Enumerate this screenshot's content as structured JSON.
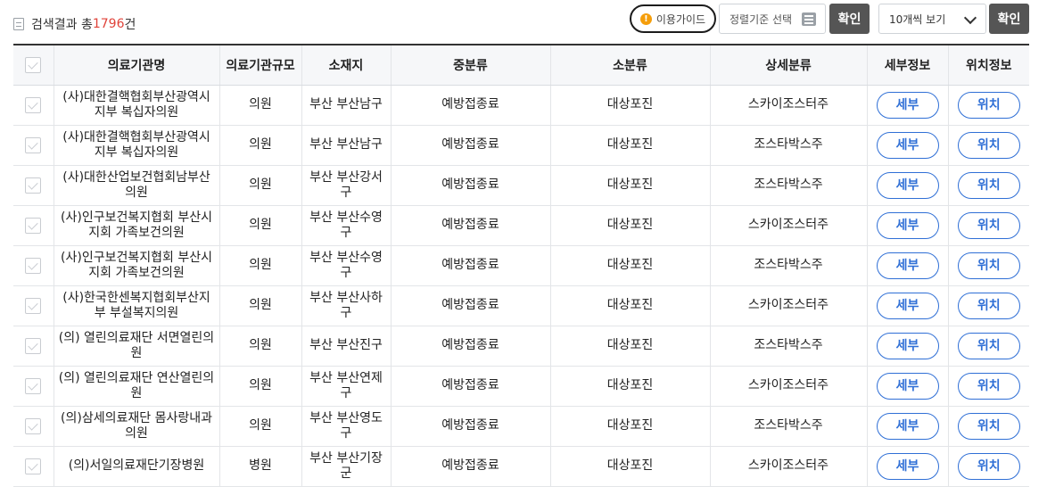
{
  "summary": {
    "prefix": "검색결과 총",
    "count": "1796",
    "suffix": "건"
  },
  "toolbar": {
    "guide_label": "이용가이드",
    "sort_placeholder": "정렬기준 선택",
    "confirm_label": "확인",
    "page_size_value": "10개씩 보기",
    "confirm2_label": "확인"
  },
  "table": {
    "headers": [
      "의료기관명",
      "의료기관규모",
      "소재지",
      "중분류",
      "소분류",
      "상세분류",
      "세부정보",
      "위치정보"
    ],
    "detail_label": "세부",
    "location_label": "위치",
    "rows": [
      {
        "name": "(사)대한결핵협회부산광역시지부 복십자의원",
        "scale": "의원",
        "location": "부산 부산남구",
        "mid": "예방접종료",
        "sub": "대상포진",
        "detail": "스카이조스터주"
      },
      {
        "name": "(사)대한결핵협회부산광역시지부 복십자의원",
        "scale": "의원",
        "location": "부산 부산남구",
        "mid": "예방접종료",
        "sub": "대상포진",
        "detail": "조스타박스주"
      },
      {
        "name": "(사)대한산업보건협회남부산의원",
        "scale": "의원",
        "location": "부산 부산강서구",
        "mid": "예방접종료",
        "sub": "대상포진",
        "detail": "조스타박스주"
      },
      {
        "name": "(사)인구보건복지협회 부산시지회 가족보건의원",
        "scale": "의원",
        "location": "부산 부산수영구",
        "mid": "예방접종료",
        "sub": "대상포진",
        "detail": "스카이조스터주"
      },
      {
        "name": "(사)인구보건복지협회 부산시지회 가족보건의원",
        "scale": "의원",
        "location": "부산 부산수영구",
        "mid": "예방접종료",
        "sub": "대상포진",
        "detail": "조스타박스주"
      },
      {
        "name": "(사)한국한센복지협회부산지부 부설복지의원",
        "scale": "의원",
        "location": "부산 부산사하구",
        "mid": "예방접종료",
        "sub": "대상포진",
        "detail": "스카이조스터주"
      },
      {
        "name": "(의) 열린의료재단 서면열린의원",
        "scale": "의원",
        "location": "부산 부산진구",
        "mid": "예방접종료",
        "sub": "대상포진",
        "detail": "조스타박스주"
      },
      {
        "name": "(의) 열린의료재단 연산열린의원",
        "scale": "의원",
        "location": "부산 부산연제구",
        "mid": "예방접종료",
        "sub": "대상포진",
        "detail": "스카이조스터주"
      },
      {
        "name": "(의)삼세의료재단 몸사랑내과의원",
        "scale": "의원",
        "location": "부산 부산영도구",
        "mid": "예방접종료",
        "sub": "대상포진",
        "detail": "조스타박스주"
      },
      {
        "name": "(의)서일의료재단기장병원",
        "scale": "병원",
        "location": "부산 부산기장군",
        "mid": "예방접종료",
        "sub": "대상포진",
        "detail": "스카이조스터주"
      }
    ]
  }
}
